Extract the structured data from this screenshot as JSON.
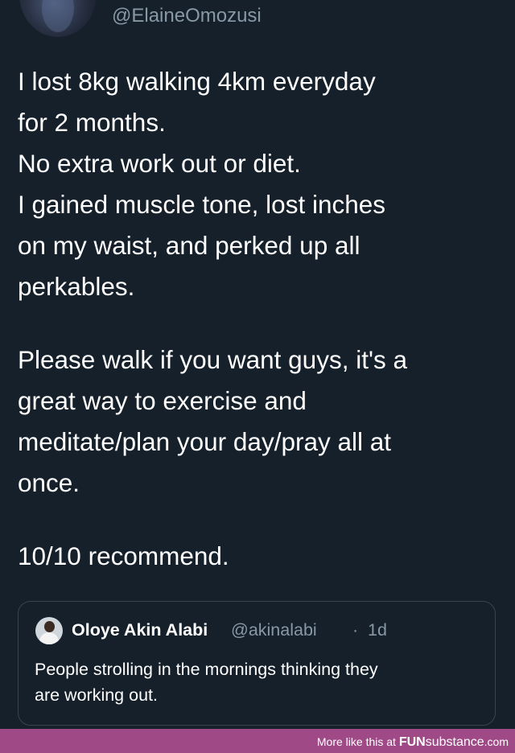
{
  "tweet": {
    "handle": "@ElaineOmozusi",
    "paragraphs": {
      "p1": [
        "I lost 8kg walking 4km everyday",
        "for 2 months.",
        "No extra work out or diet.",
        "I gained muscle tone, lost inches",
        "on my waist, and perked up all",
        "perkables."
      ],
      "p2": [
        "Please walk if you want guys, it's a",
        "great way to exercise and",
        "meditate/plan your day/pray all at",
        "once."
      ],
      "p3": [
        "10/10 recommend."
      ]
    }
  },
  "quoted_tweet": {
    "name": "Oloye Akin Alabi",
    "handle": "@akinalabi",
    "separator": "·",
    "time": "1d",
    "lines": [
      "People strolling in the mornings thinking they",
      "are working out."
    ]
  },
  "watermark": {
    "prefix": "More like this at ",
    "brand_bold": "FUN",
    "brand_light": "substance",
    "suffix": ".com"
  }
}
